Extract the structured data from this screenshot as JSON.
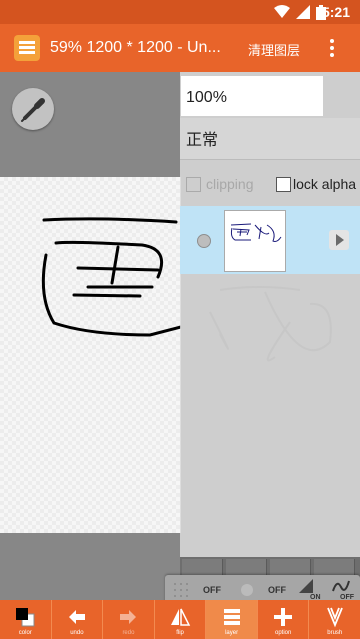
{
  "status_bar": {
    "time": "5:21"
  },
  "app_bar": {
    "title": "59% 1200 * 1200 - Un...",
    "clear_layer_label": "清理图层"
  },
  "layer_panel": {
    "opacity": "100%",
    "blend_mode": "正常",
    "clipping_label": "clipping",
    "lock_alpha_label": "lock alpha"
  },
  "brush_bar": {
    "toggle_1": "OFF",
    "toggle_2": "OFF",
    "toggle_3": "ON",
    "toggle_4": "OFF"
  },
  "toolbar": {
    "items": [
      {
        "label": "color"
      },
      {
        "label": "undo"
      },
      {
        "label": "redo"
      },
      {
        "label": "flip"
      },
      {
        "label": "layer"
      },
      {
        "label": "option"
      },
      {
        "label": "brush"
      }
    ]
  },
  "colors": {
    "accent": "#e8642a",
    "status_bar": "#d4541f",
    "layer_selected": "#bfe3f6"
  }
}
